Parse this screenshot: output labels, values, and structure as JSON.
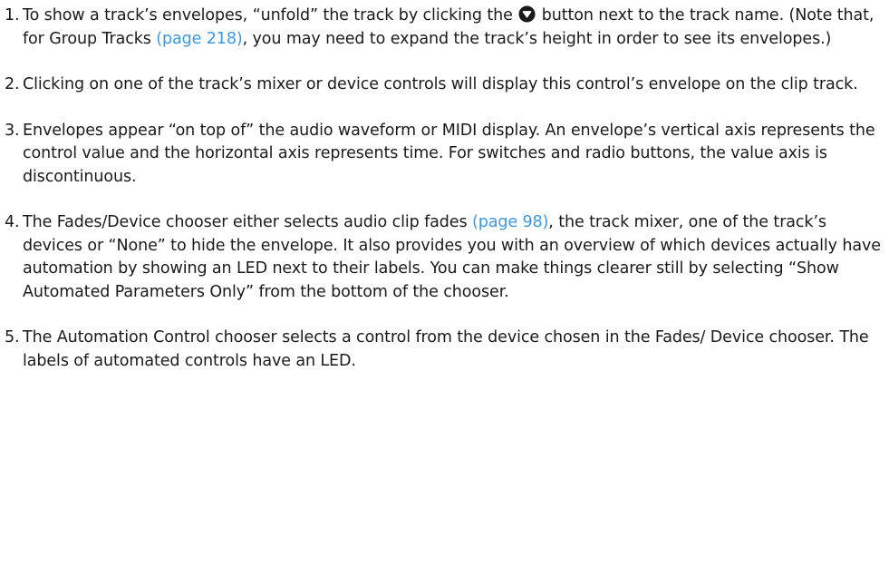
{
  "items": [
    {
      "number": "1.",
      "before_icon": "To show a track’s envelopes, “unfold” the track by clicking the",
      "icon": "unfold-triangle-icon",
      "after_icon": " button next to the track name. (Note that, for Group Tracks ",
      "link": "(page 218)",
      "after_link": ", you may need to expand the track’s height in order to see its envelopes.)"
    },
    {
      "number": "2.",
      "text": "Clicking on one of the track’s mixer or device controls will display this control’s envelope on the clip track."
    },
    {
      "number": "3.",
      "text": "Envelopes appear “on top of” the audio waveform or MIDI display. An envelope’s vertical axis represents the control value and the horizontal axis represents time. For switches and radio buttons, the value axis is discontinuous."
    },
    {
      "number": "4.",
      "before_link": "The Fades/Device chooser either selects audio clip fades ",
      "link": "(page 98)",
      "after_link": ", the track mixer, one of the track’s devices or “None” to hide the envelope. It also provides you with an overview of which devices actually have automation by showing an LED next to their la­bels. You can make things clearer still by selecting “Show Automated Parameters Only” from the bottom of the chooser."
    },
    {
      "number": "5.",
      "text": "The Automation Control chooser selects a control from the device chosen in the Fades/ Device chooser. The labels of automated controls have an LED."
    }
  ],
  "colors": {
    "text": "#1a1a1a",
    "link": "#3c97e6"
  }
}
